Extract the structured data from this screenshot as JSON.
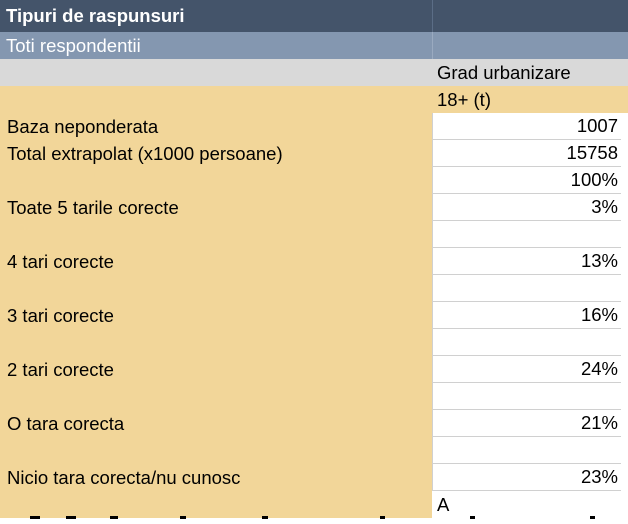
{
  "header": {
    "title": "Tipuri de raspunsuri",
    "subtitle": "Toti respondentii",
    "column_group": "Grad urbanizare",
    "column": "18+ (t)"
  },
  "rows": [
    {
      "label": "Baza neponderata",
      "value": "1007"
    },
    {
      "label": "Total extrapolat (x1000 persoane)",
      "value": "15758"
    },
    {
      "label": "",
      "value": "100%"
    },
    {
      "label": "Toate 5 tarile corecte",
      "value": "3%"
    },
    {
      "label": "",
      "value": ""
    },
    {
      "label": "4 tari corecte",
      "value": "13%"
    },
    {
      "label": "",
      "value": ""
    },
    {
      "label": "3 tari corecte",
      "value": "16%"
    },
    {
      "label": "",
      "value": ""
    },
    {
      "label": "2 tari corecte",
      "value": "24%"
    },
    {
      "label": "",
      "value": ""
    },
    {
      "label": "O tara corecta",
      "value": "21%"
    },
    {
      "label": "",
      "value": ""
    },
    {
      "label": "Nicio tara corecta/nu cunosc",
      "value": "23%"
    }
  ],
  "footer_marker": "A",
  "colors": {
    "title_bg": "#44546a",
    "subtitle_bg": "#8497b0",
    "column_header_bg": "#d9d9d9",
    "label_bg": "#f2d699"
  }
}
